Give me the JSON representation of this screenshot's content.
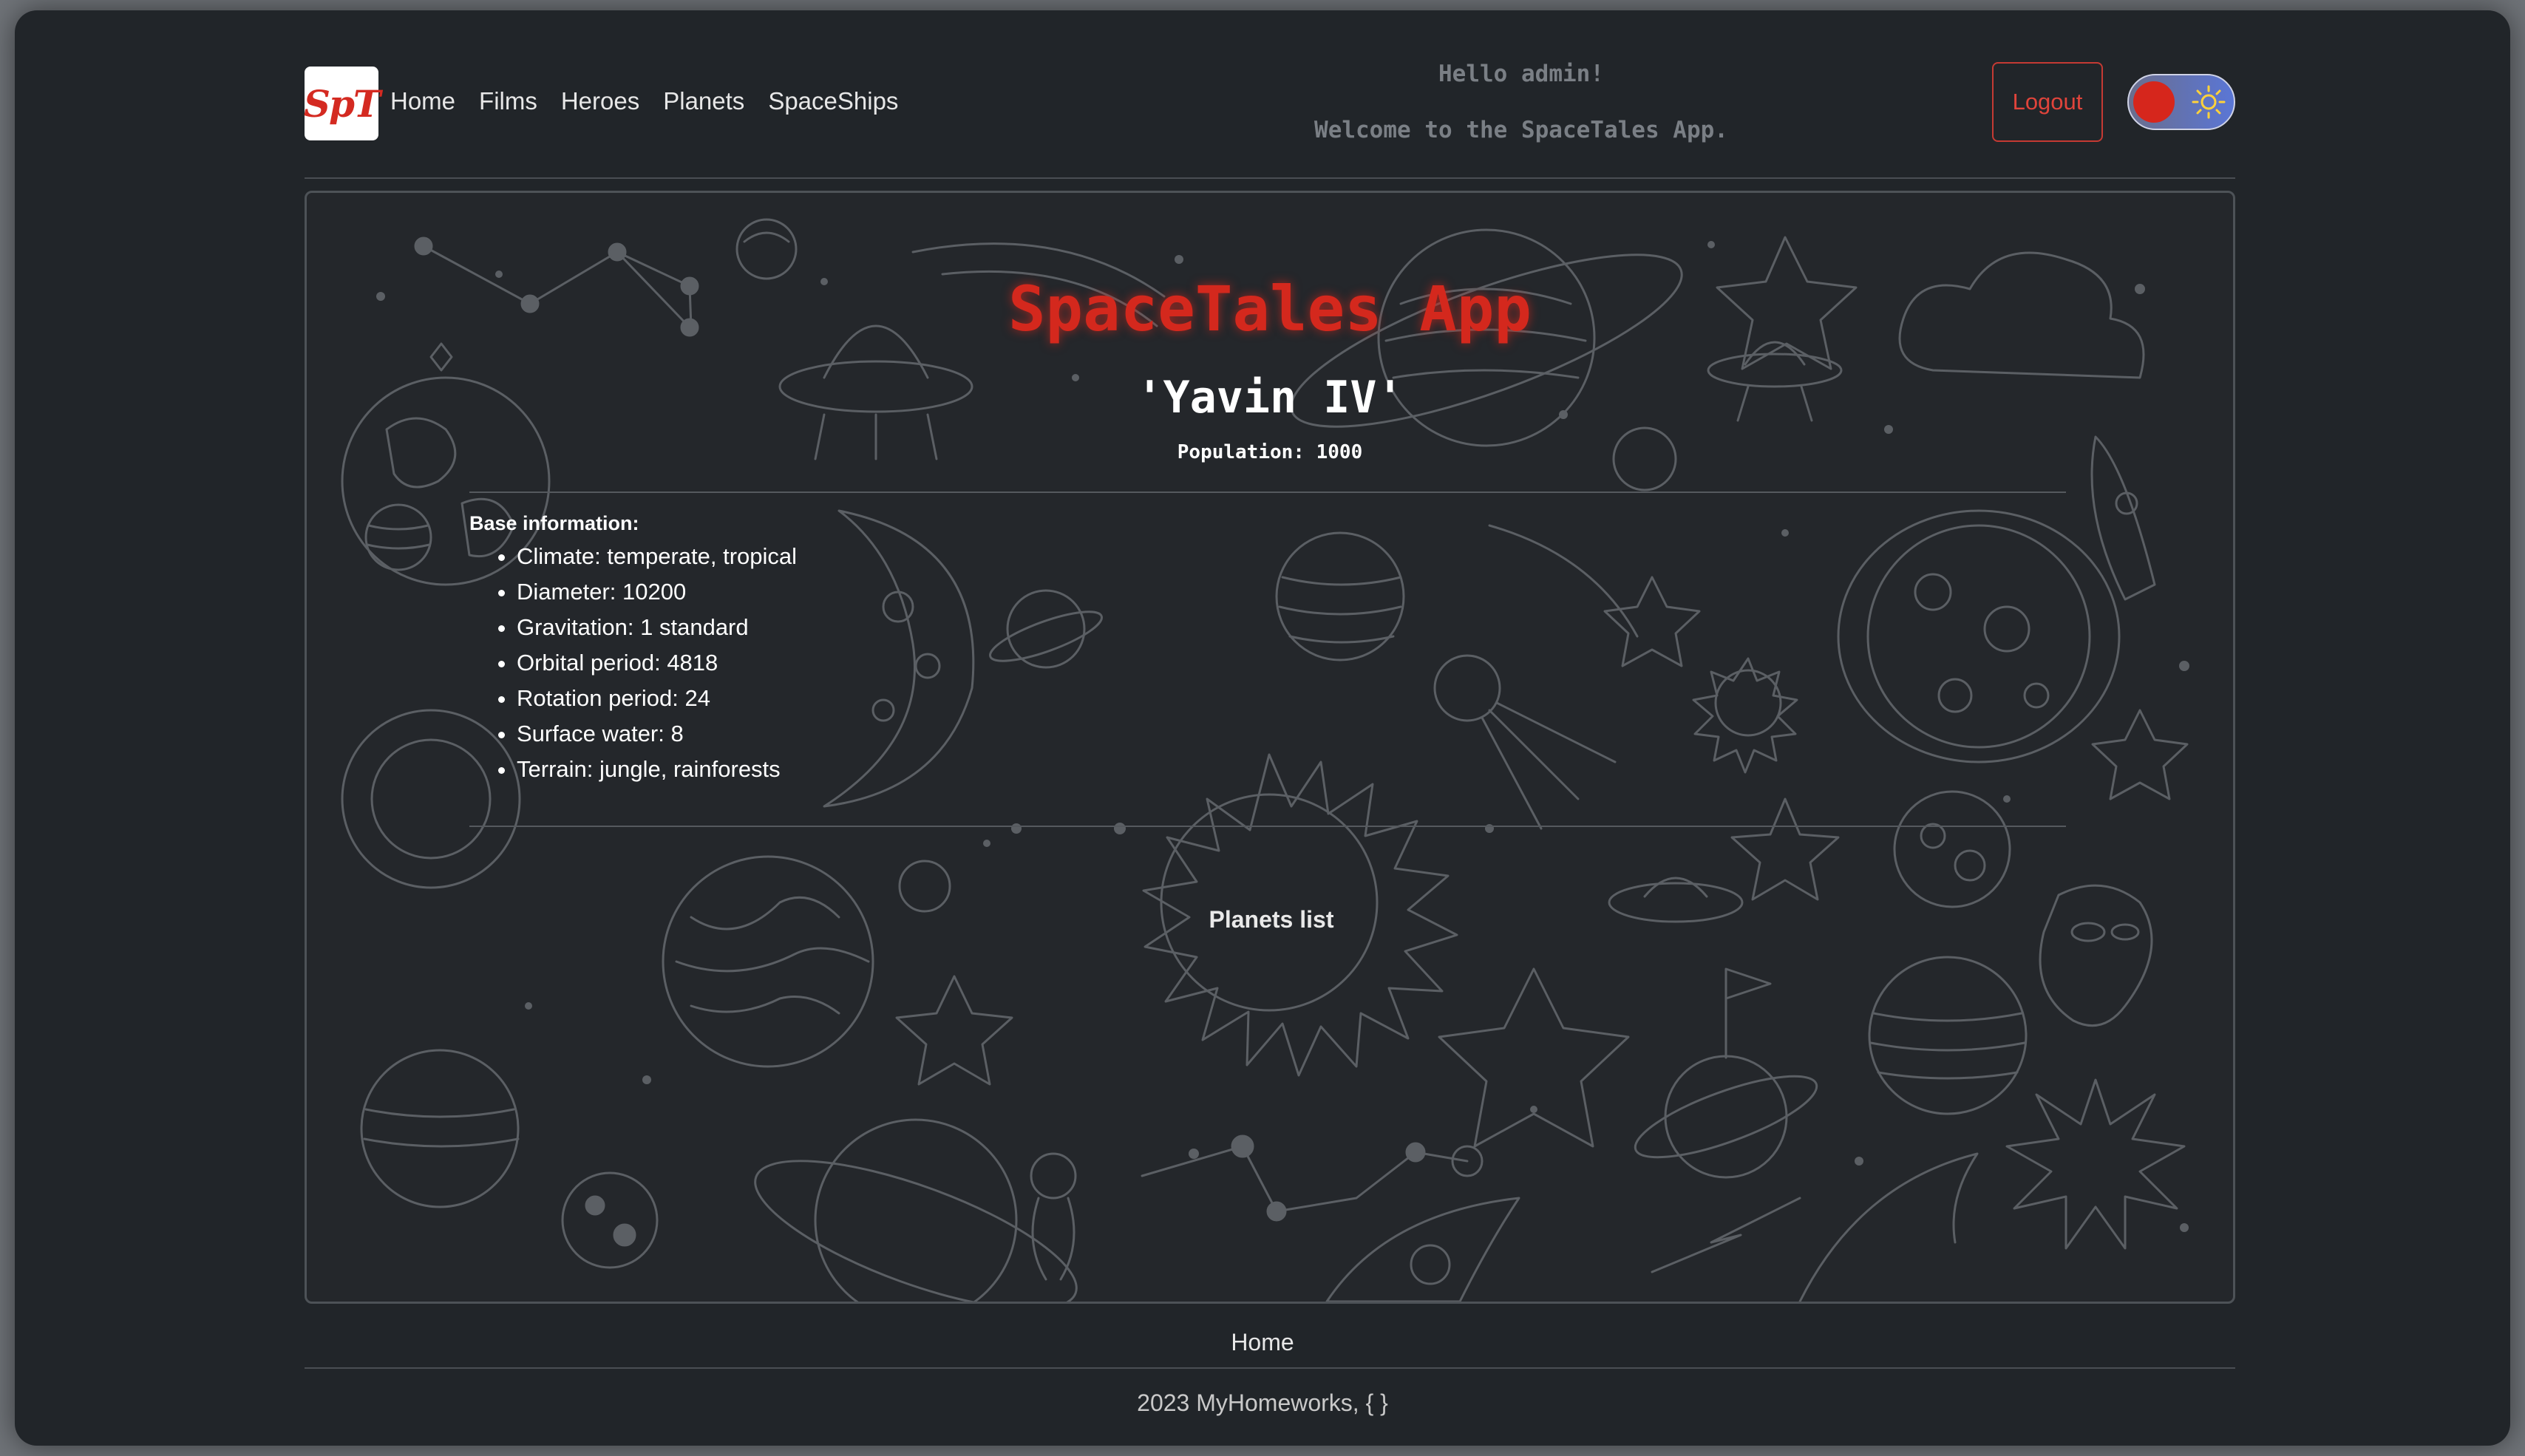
{
  "brand": {
    "logo_text": "SpT"
  },
  "nav": {
    "items": [
      {
        "label": "Home"
      },
      {
        "label": "Films"
      },
      {
        "label": "Heroes"
      },
      {
        "label": "Planets"
      },
      {
        "label": "SpaceShips"
      }
    ]
  },
  "greeting": {
    "line1": "Hello admin!",
    "line2": "Welcome to the SpaceTales App."
  },
  "header_actions": {
    "logout_label": "Logout",
    "theme_toggle": {
      "state": "light-sun",
      "knob_color": "#d6261c"
    }
  },
  "main": {
    "app_title": "SpaceTales App",
    "planet_name": "'Yavin IV'",
    "population": "Population: 1000",
    "base_info_label": "Base information:",
    "base_info": [
      "Climate: temperate, tropical",
      "Diameter: 10200",
      "Gravitation: 1 standard",
      "Orbital period: 4818",
      "Rotation period: 24",
      "Surface water: 8",
      "Terrain: jungle, rainforests"
    ],
    "planets_list_label": "Planets list"
  },
  "footer": {
    "home_label": "Home",
    "copyright": "2023 MyHomeworks, { }"
  },
  "colors": {
    "background": "#212529",
    "accent_red": "#d4281d",
    "text": "#ffffff",
    "doodle_stroke": "#5b5f64"
  }
}
